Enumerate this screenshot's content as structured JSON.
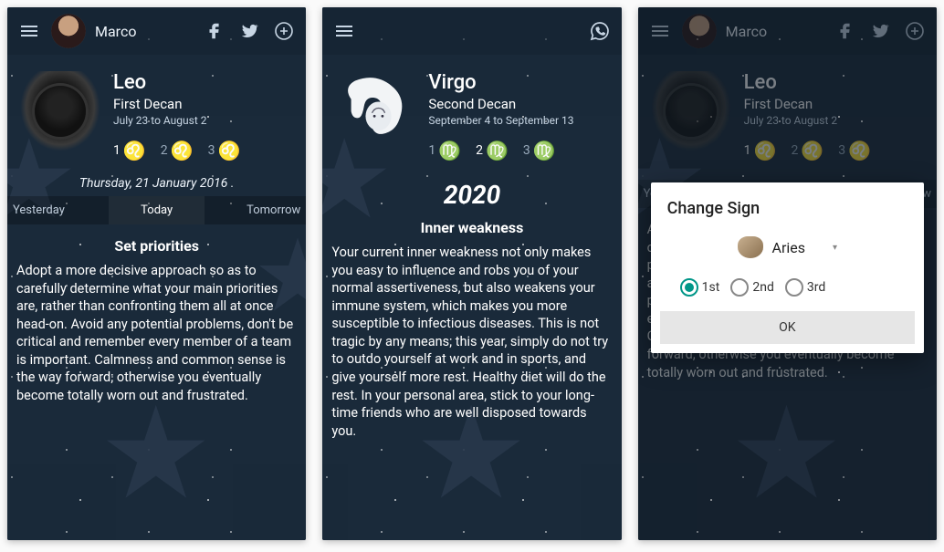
{
  "screen1": {
    "user": "Marco",
    "sign": "Leo",
    "decan": "First Decan",
    "range": "July 23 to August 2",
    "decans": {
      "d1": "1",
      "d2": "2",
      "d3": "3"
    },
    "date": "Thursday, 21 January 2016 .",
    "tabs": {
      "yesterday": "Yesterday",
      "today": "Today",
      "tomorrow": "Tomorrow"
    },
    "title": "Set priorities",
    "body": "Adopt a more decisive approach so as to carefully determine what your main priorities are, rather than confronting them all at once head-on. Avoid any potential problems, don't be critical and remember every member of a team is important. Calmness and common sense is the way forward; otherwise you eventually become totally worn out and frustrated."
  },
  "screen2": {
    "sign": "Virgo",
    "decan": "Second Decan",
    "range": "September 4 to September 13",
    "decans": {
      "d1": "1",
      "d2": "2",
      "d3": "3"
    },
    "year": "2020",
    "title": "Inner weakness",
    "body": "Your current inner weakness not only makes you easy to influence and robs you of your normal assertiveness, but also weakens your immune system, which makes you more susceptible to infectious diseases. This is not tragic by any means; this year, simply do not try to outdo yourself at work and in sports, and give yourself more rest. Healthy diet will do the rest. In your personal area, stick to your long-time friends who are well disposed towards you."
  },
  "screen3": {
    "user": "Marco",
    "sign": "Leo",
    "decan": "First Decan",
    "range": "July 23 to August 2",
    "decans": {
      "d1": "1",
      "d2": "2",
      "d3": "3"
    },
    "tabs": {
      "yesterday": "Yest",
      "tomorrow": "rrow"
    },
    "body_partial_top1": "Ad",
    "body_partial_top2": "car",
    "body_partial_top3": "prio",
    "body_partial_top4": "all",
    "body_partial_top5": "pro",
    "body_partial_top6": "eve",
    "body_partial_side": "m",
    "body_partial_bottom": "Calmness and common sense is the way forward; otherwise you eventually become totally worn out and frustrated.",
    "dialog": {
      "title": "Change Sign",
      "sign": "Aries",
      "options": {
        "o1": "1st",
        "o2": "2nd",
        "o3": "3rd"
      },
      "ok": "OK"
    }
  }
}
